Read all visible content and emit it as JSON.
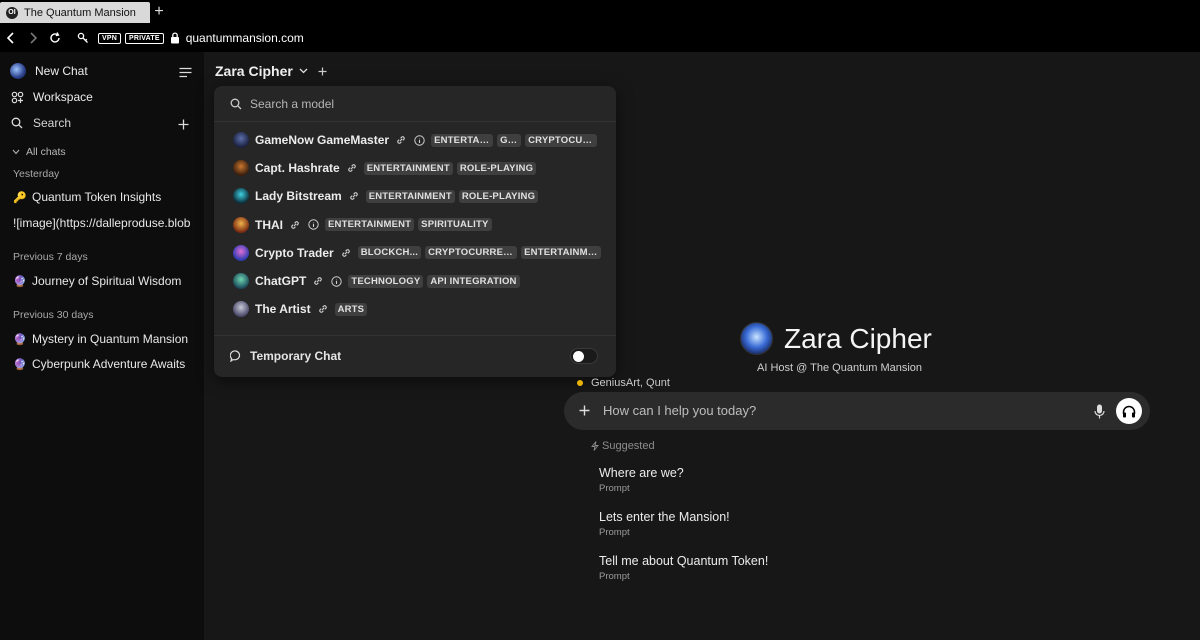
{
  "browser": {
    "tab_title": "The Quantum Mansion",
    "tab_favicon": "OI",
    "new_tab_label": "+",
    "badges": [
      "VPN",
      "PRIVATE"
    ],
    "url": "quantummansion.com"
  },
  "sidebar": {
    "new_chat": "New Chat",
    "workspace": "Workspace",
    "search": "Search",
    "all_chats": "All chats",
    "sections": [
      {
        "label": "Yesterday",
        "chats": [
          {
            "emoji": "🔑",
            "title": "Quantum Token Insights"
          },
          {
            "emoji": "",
            "title": "![image](https://dalleproduse.blob"
          }
        ]
      },
      {
        "label": "Previous 7 days",
        "chats": [
          {
            "emoji": "🔮",
            "title": "Journey of Spiritual Wisdom"
          }
        ]
      },
      {
        "label": "Previous 30 days",
        "chats": [
          {
            "emoji": "🔮",
            "title": "Mystery in Quantum Mansion"
          },
          {
            "emoji": "🔮",
            "title": "Cyberpunk Adventure Awaits"
          }
        ]
      }
    ]
  },
  "header": {
    "model_name": "Zara Cipher"
  },
  "dropdown": {
    "search_placeholder": "Search a model",
    "models": [
      {
        "name": "GameNow GameMaster",
        "info": true,
        "tags": [
          "ENTERTAI...",
          "GA...",
          "CRYPTOCUR..."
        ]
      },
      {
        "name": "Capt. Hashrate",
        "info": false,
        "tags": [
          "ENTERTAINMENT",
          "ROLE-PLAYING"
        ]
      },
      {
        "name": "Lady Bitstream",
        "info": false,
        "tags": [
          "ENTERTAINMENT",
          "ROLE-PLAYING"
        ]
      },
      {
        "name": "THAI",
        "info": true,
        "tags": [
          "ENTERTAINMENT",
          "SPIRITUALITY"
        ]
      },
      {
        "name": "Crypto Trader",
        "info": false,
        "tags": [
          "BLOCKCH...",
          "CRYPTOCURREN...",
          "ENTERTAINME..."
        ]
      },
      {
        "name": "ChatGPT",
        "info": true,
        "tags": [
          "TECHNOLOGY",
          "API INTEGRATION"
        ]
      },
      {
        "name": "The Artist",
        "info": false,
        "tags": [
          "ARTS"
        ]
      }
    ],
    "temporary_chat": "Temporary Chat",
    "temporary_chat_enabled": false
  },
  "main": {
    "title": "Zara Cipher",
    "subtitle": "AI Host @ The Quantum Mansion",
    "active_users": "GeniusArt, Qunt",
    "input_placeholder": "How can I help you today?",
    "suggested_label": "Suggested",
    "suggestions": [
      {
        "title": "Where are we?",
        "sub": "Prompt"
      },
      {
        "title": "Lets enter the Mansion!",
        "sub": "Prompt"
      },
      {
        "title": "Tell me about Quantum Token!",
        "sub": "Prompt"
      }
    ]
  },
  "colors": {
    "background": "#171717",
    "sidebar": "#0d0d0d",
    "dropdown": "#262626",
    "status_dot": "#eab308"
  }
}
